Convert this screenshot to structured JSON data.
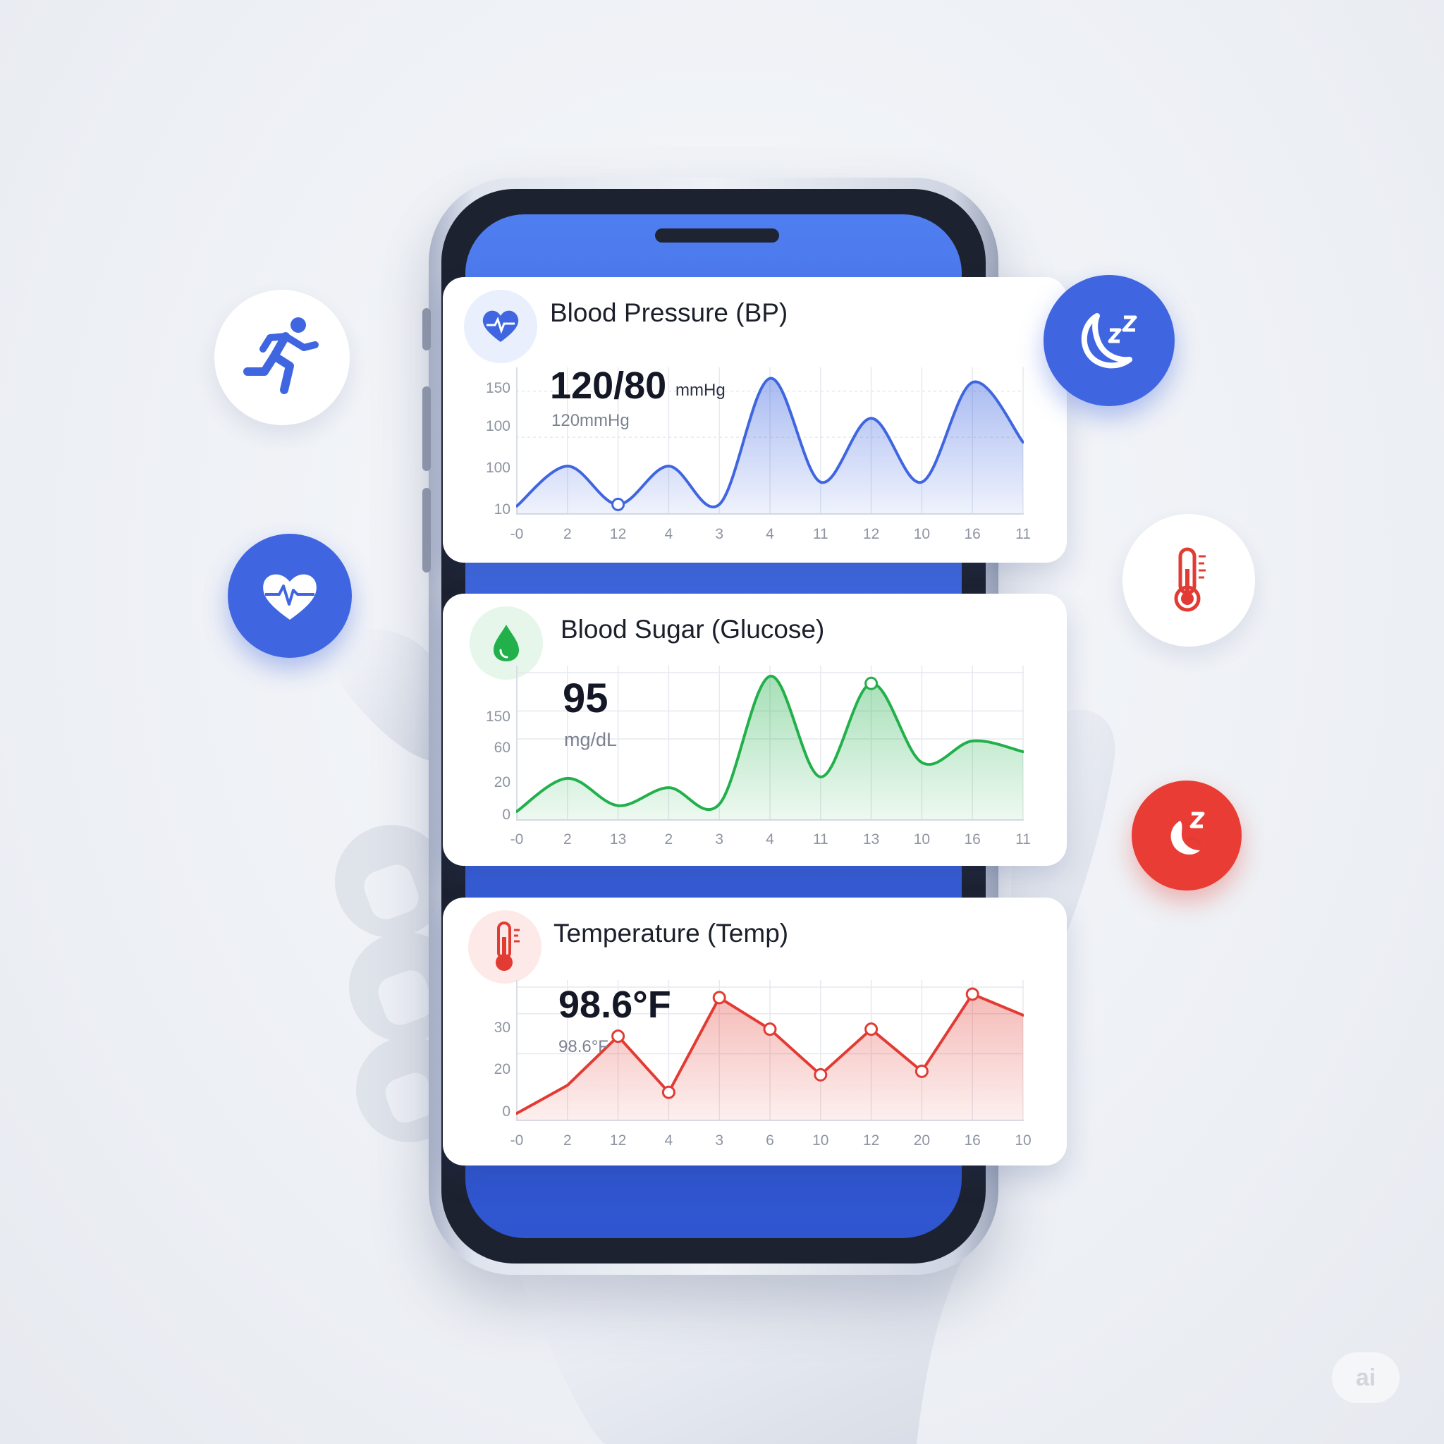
{
  "cards": {
    "bp": {
      "title": "Blood Pressure (BP)",
      "value": "120/80",
      "unit": "mmHg",
      "sub": "120mmHg",
      "y_ticks": [
        "150",
        "100",
        "100",
        "10"
      ],
      "x_ticks": [
        "-0",
        "2",
        "12",
        "4",
        "3",
        "4",
        "11",
        "12",
        "10",
        "16",
        "11"
      ],
      "color": "#3f66e0"
    },
    "glucose": {
      "title": "Blood Sugar (Glucose)",
      "value": "95",
      "sub": "mg/dL",
      "y_ticks": [
        "150",
        "60",
        "20",
        "0"
      ],
      "x_ticks": [
        "-0",
        "2",
        "13",
        "2",
        "3",
        "4",
        "11",
        "13",
        "10",
        "16",
        "11"
      ],
      "color": "#22b04b"
    },
    "temp": {
      "title": "Temperature (Temp)",
      "value": "98.6°F",
      "sub": "98.6°F",
      "y_ticks": [
        "30",
        "20",
        "0"
      ],
      "x_ticks": [
        "-0",
        "2",
        "12",
        "4",
        "3",
        "6",
        "10",
        "12",
        "20",
        "16",
        "10"
      ],
      "color": "#e23b33"
    }
  },
  "floating_icons": [
    "running-person-icon",
    "sleep-moon-icon",
    "heart-pulse-icon",
    "thermometer-icon",
    "sleep-badge-icon"
  ],
  "watermark": "ai",
  "chart_data": [
    {
      "type": "area",
      "title": "Blood Pressure (BP)",
      "x": [
        "-0",
        "2",
        "12",
        "4",
        "3",
        "4",
        "11",
        "12",
        "10",
        "16",
        "11"
      ],
      "y_tick_labels": [
        "150",
        "100",
        "100",
        "10"
      ],
      "series": [
        {
          "values": [
            10,
            60,
            12,
            60,
            12,
            170,
            40,
            120,
            40,
            165,
            90
          ]
        }
      ]
    },
    {
      "type": "area",
      "title": "Blood Sugar (Glucose)",
      "x": [
        "-0",
        "2",
        "13",
        "2",
        "3",
        "4",
        "11",
        "13",
        "10",
        "16",
        "11"
      ],
      "y_tick_labels": [
        "150",
        "60",
        "20",
        "0"
      ],
      "series": [
        {
          "values": [
            12,
            58,
            20,
            45,
            22,
            200,
            60,
            190,
            80,
            110,
            95
          ]
        }
      ]
    },
    {
      "type": "area",
      "title": "Temperature (Temp)",
      "x": [
        "-0",
        "2",
        "12",
        "4",
        "3",
        "6",
        "10",
        "12",
        "20",
        "16",
        "10"
      ],
      "y_tick_labels": [
        "30",
        "20",
        "0"
      ],
      "series": [
        {
          "values": [
            2,
            10,
            24,
            8,
            35,
            26,
            13,
            26,
            14,
            36,
            30
          ]
        }
      ]
    }
  ]
}
